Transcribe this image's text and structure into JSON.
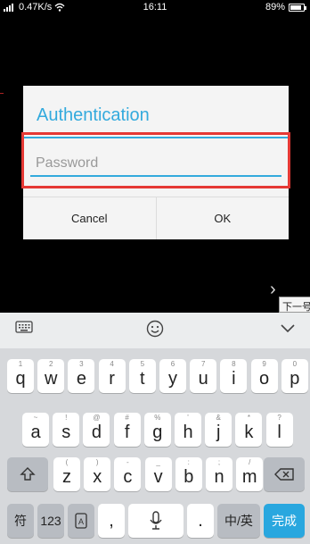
{
  "status_bar": {
    "speed": "0.47K/s",
    "time": "16:11",
    "battery": "89%",
    "battery_level": 0.89
  },
  "background": {
    "tooltip": "下一号"
  },
  "dialog": {
    "title": "Authentication",
    "password_placeholder": "Password",
    "cancel_label": "Cancel",
    "ok_label": "OK"
  },
  "keyboard": {
    "toolbar": [
      "keyboard-icon",
      "emoji-icon",
      "chevron-down-icon"
    ],
    "row1": [
      {
        "key": "q",
        "sub": "1"
      },
      {
        "key": "w",
        "sub": "2"
      },
      {
        "key": "e",
        "sub": "3"
      },
      {
        "key": "r",
        "sub": "4"
      },
      {
        "key": "t",
        "sub": "5"
      },
      {
        "key": "y",
        "sub": "6"
      },
      {
        "key": "u",
        "sub": "7"
      },
      {
        "key": "i",
        "sub": "8"
      },
      {
        "key": "o",
        "sub": "9"
      },
      {
        "key": "p",
        "sub": "0"
      }
    ],
    "row2": [
      {
        "key": "a",
        "sub": "~"
      },
      {
        "key": "s",
        "sub": "!"
      },
      {
        "key": "d",
        "sub": "@"
      },
      {
        "key": "f",
        "sub": "#"
      },
      {
        "key": "g",
        "sub": "%"
      },
      {
        "key": "h",
        "sub": "'"
      },
      {
        "key": "j",
        "sub": "&"
      },
      {
        "key": "k",
        "sub": "*"
      },
      {
        "key": "l",
        "sub": "?"
      }
    ],
    "row3": [
      {
        "key": "z",
        "sub": "("
      },
      {
        "key": "x",
        "sub": ")"
      },
      {
        "key": "c",
        "sub": "-"
      },
      {
        "key": "v",
        "sub": "_"
      },
      {
        "key": "b",
        "sub": ":"
      },
      {
        "key": "n",
        "sub": ";"
      },
      {
        "key": "m",
        "sub": "/"
      }
    ],
    "symbols_label": "符",
    "numbers_label": "123",
    "comma_label": ",",
    "period_label": ".",
    "lang_label": "中/英",
    "done_label": "完成"
  },
  "colors": {
    "accent": "#33aadd",
    "highlight": "#e53935",
    "done": "#29a7df"
  }
}
